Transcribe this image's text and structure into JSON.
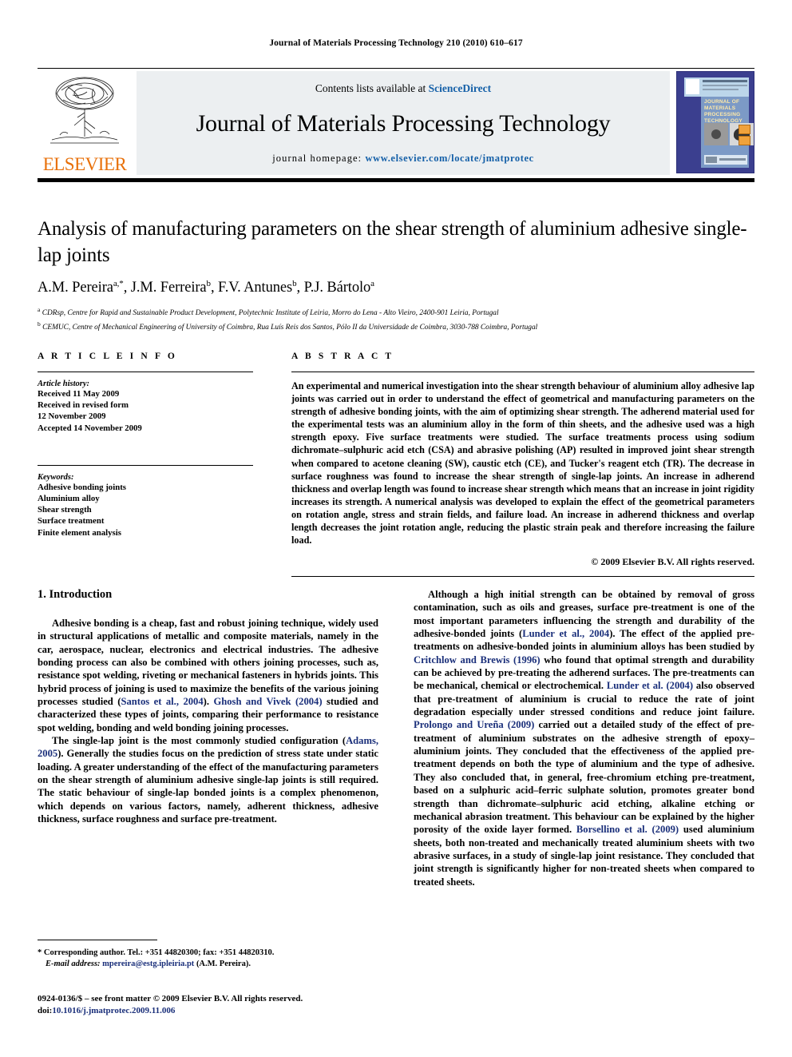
{
  "running_head": "Journal of Materials Processing Technology 210 (2010) 610–617",
  "masthead": {
    "contents_prefix": "Contents lists available at",
    "contents_link": "ScienceDirect",
    "journal_title": "Journal of Materials Processing Technology",
    "homepage_prefix": "journal homepage:",
    "homepage_url": "www.elsevier.com/locate/jmatprotec",
    "publisher_name": "ELSEVIER",
    "cover_title": "JOURNAL OF MATERIALS PROCESSING TECHNOLOGY"
  },
  "article": {
    "title": "Analysis of manufacturing parameters on the shear strength of aluminium adhesive single-lap joints",
    "authors": "A.M. Pereira a,*, J.M. Ferreira b, F.V. Antunes b, P.J. Bártolo a",
    "affiliation_a": "CDRsp, Centre for Rapid and Sustainable Product Development, Polytechnic Institute of Leiria, Morro do Lena - Alto Vieiro, 2400-901 Leiria, Portugal",
    "affiliation_b": "CEMUC, Centre of Mechanical Engineering of University of Coimbra, Rua Luís Reis dos Santos, Pólo II da Universidade de Coimbra, 3030-788 Coimbra, Portugal"
  },
  "article_info": {
    "heading": "A R T I C L E    I N F O",
    "history_label": "Article history:",
    "history": [
      "Received 11 May 2009",
      "Received in revised form",
      "12 November 2009",
      "Accepted 14 November 2009"
    ],
    "keywords_label": "Keywords:",
    "keywords": [
      "Adhesive bonding joints",
      "Aluminium alloy",
      "Shear strength",
      "Surface treatment",
      "Finite element analysis"
    ]
  },
  "abstract": {
    "heading": "A B S T R A C T",
    "text": "An experimental and numerical investigation into the shear strength behaviour of aluminium alloy adhesive lap joints was carried out in order to understand the effect of geometrical and manufacturing parameters on the strength of adhesive bonding joints, with the aim of optimizing shear strength. The adherend material used for the experimental tests was an aluminium alloy in the form of thin sheets, and the adhesive used was a high strength epoxy. Five surface treatments were studied. The surface treatments process using sodium dichromate–sulphuric acid etch (CSA) and abrasive polishing (AP) resulted in improved joint shear strength when compared to acetone cleaning (SW), caustic etch (CE), and Tucker's reagent etch (TR). The decrease in surface roughness was found to increase the shear strength of single-lap joints. An increase in adherend thickness and overlap length was found to increase shear strength which means that an increase in joint rigidity increases its strength. A numerical analysis was developed to explain the effect of the geometrical parameters on rotation angle, stress and strain fields, and failure load. An increase in adherend thickness and overlap length decreases the joint rotation angle, reducing the plastic strain peak and therefore increasing the failure load.",
    "copyright": "© 2009 Elsevier B.V. All rights reserved."
  },
  "body": {
    "section_number_title": "1.  Introduction",
    "left_paragraphs": [
      {
        "runs": [
          {
            "t": "Adhesive bonding is a cheap, fast and robust joining technique, widely used in structural applications of metallic and composite materials, namely in the car, aerospace, nuclear, electronics and electrical industries. The adhesive bonding process can also be combined with others joining processes, such as, resistance spot welding, riveting or mechanical fasteners in hybrids joints. This hybrid process of joining is used to maximize the benefits of the various joining processes studied ("
          },
          {
            "t": "Santos et al., 2004",
            "cite": true
          },
          {
            "t": "). "
          },
          {
            "t": "Ghosh and Vivek (2004)",
            "cite": true
          },
          {
            "t": " studied and characterized these types of joints, comparing their performance to resistance spot welding, bonding and weld bonding joining processes."
          }
        ]
      },
      {
        "runs": [
          {
            "t": "The single-lap joint is the most commonly studied configuration ("
          },
          {
            "t": "Adams, 2005",
            "cite": true
          },
          {
            "t": "). Generally the studies focus on the prediction of stress state under static loading. A greater understanding of the effect of the manufacturing parameters on the shear strength of aluminium adhesive single-lap joints is still required. The static behaviour of single-lap bonded joints is a complex phenomenon, which depends on various factors, namely, adherent thickness, adhesive thickness, surface roughness and surface pre-treatment."
          }
        ]
      }
    ],
    "right_paragraphs": [
      {
        "runs": [
          {
            "t": "Although a high initial strength can be obtained by removal of gross contamination, such as oils and greases, surface pre-treatment is one of the most important parameters influencing the strength and durability of the adhesive-bonded joints ("
          },
          {
            "t": "Lunder et al., 2004",
            "cite": true
          },
          {
            "t": "). The effect of the applied pre-treatments on adhesive-bonded joints in aluminium alloys has been studied by "
          },
          {
            "t": "Critchlow and Brewis (1996)",
            "cite": true
          },
          {
            "t": " who found that optimal strength and durability can be achieved by pre-treating the adherend surfaces. The pre-treatments can be mechanical, chemical or electrochemical. "
          },
          {
            "t": "Lunder et al. (2004)",
            "cite": true
          },
          {
            "t": " also observed that pre-treatment of aluminium is crucial to reduce the rate of joint degradation especially under stressed conditions and reduce joint failure. "
          },
          {
            "t": "Prolongo and Ureña (2009)",
            "cite": true
          },
          {
            "t": " carried out a detailed study of the effect of pre-treatment of aluminium substrates on the adhesive strength of epoxy–aluminium joints. They concluded that the effectiveness of the applied pre-treatment depends on both the type of aluminium and the type of adhesive. They also concluded that, in general, free-chromium etching pre-treatment, based on a sulphuric acid–ferric sulphate solution, promotes greater bond strength than dichromate–sulphuric acid etching, alkaline etching or mechanical abrasion treatment. This behaviour can be explained by the higher porosity of the oxide layer formed. "
          },
          {
            "t": "Borsellino et al. (2009)",
            "cite": true
          },
          {
            "t": " used aluminium sheets, both non-treated and mechanically treated aluminium sheets with two abrasive surfaces, in a study of single-lap joint resistance. They concluded that joint strength is significantly higher for non-treated sheets when compared to treated sheets."
          }
        ]
      }
    ]
  },
  "footnotes": {
    "corresponding": "* Corresponding author. Tel.: +351 44820300; fax: +351 44820310.",
    "email_label": "E-mail address:",
    "email": "mpereira@estg.ipleiria.pt",
    "email_suffix": "(A.M. Pereira).",
    "issn_line": "0924-0136/$ – see front matter © 2009 Elsevier B.V. All rights reserved.",
    "doi_label": "doi:",
    "doi": "10.1016/j.jmatprotec.2009.11.006"
  },
  "colors": {
    "link_blue": "#1560a8",
    "cite_blue": "#1a2f7a",
    "elsevier_orange": "#e8700a",
    "masthead_grey": "#eceff1",
    "cover_blue": "#3b3f8f"
  }
}
